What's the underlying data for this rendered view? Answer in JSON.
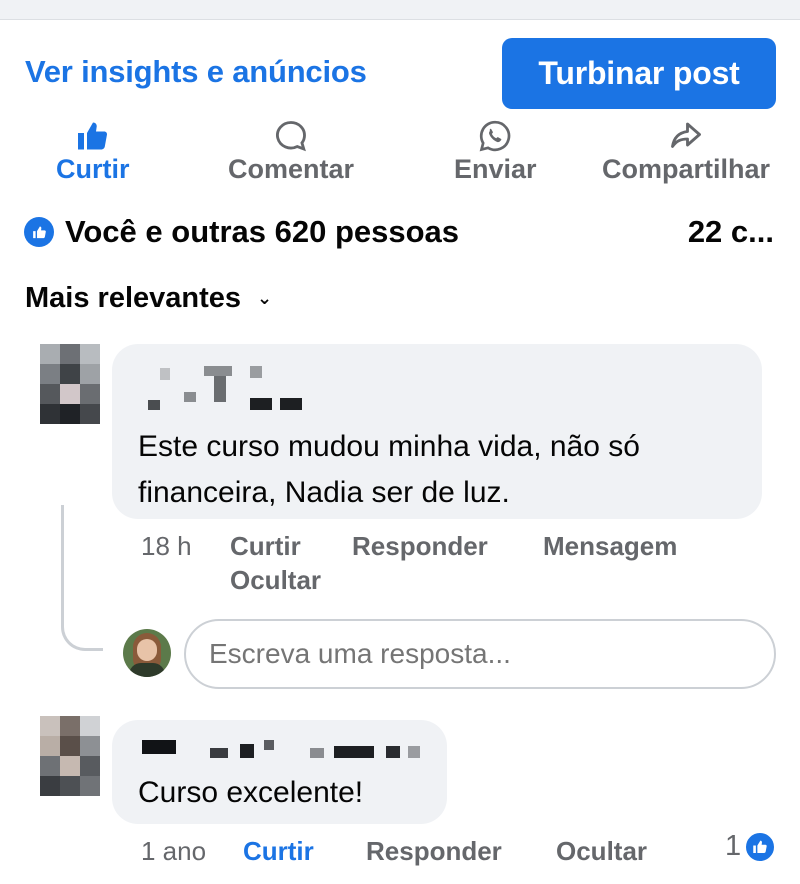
{
  "top": {
    "insights_link": "Ver insights e anúncios",
    "boost_button": "Turbinar post"
  },
  "actions": {
    "like": "Curtir",
    "comment": "Comentar",
    "send": "Enviar",
    "share": "Compartilhar"
  },
  "reactions": {
    "summary": "Você e outras 620 pessoas",
    "comments_count": "22 c..."
  },
  "sort": {
    "label": "Mais relevantes"
  },
  "comments": [
    {
      "author_name": "",
      "text": "Este curso mudou minha vida, não só financeira, Nadia ser de luz.",
      "time": "18 h",
      "like": "Curtir",
      "reply": "Responder",
      "message": "Mensagem",
      "hide": "Ocultar"
    },
    {
      "author_name": "",
      "text": "Curso excelente!",
      "time": "1 ano",
      "like": "Curtir",
      "reply": "Responder",
      "hide": "Ocultar",
      "like_count": "1"
    }
  ],
  "reply_box": {
    "placeholder": "Escreva uma resposta..."
  },
  "colors": {
    "accent": "#1b74e4",
    "muted": "#65676b",
    "bubble": "#f0f2f5"
  },
  "icons": {
    "like": "thumbs-up-icon",
    "comment": "comment-icon",
    "send": "whatsapp-icon",
    "share": "share-arrow-icon",
    "sort": "chevron-down-icon"
  }
}
